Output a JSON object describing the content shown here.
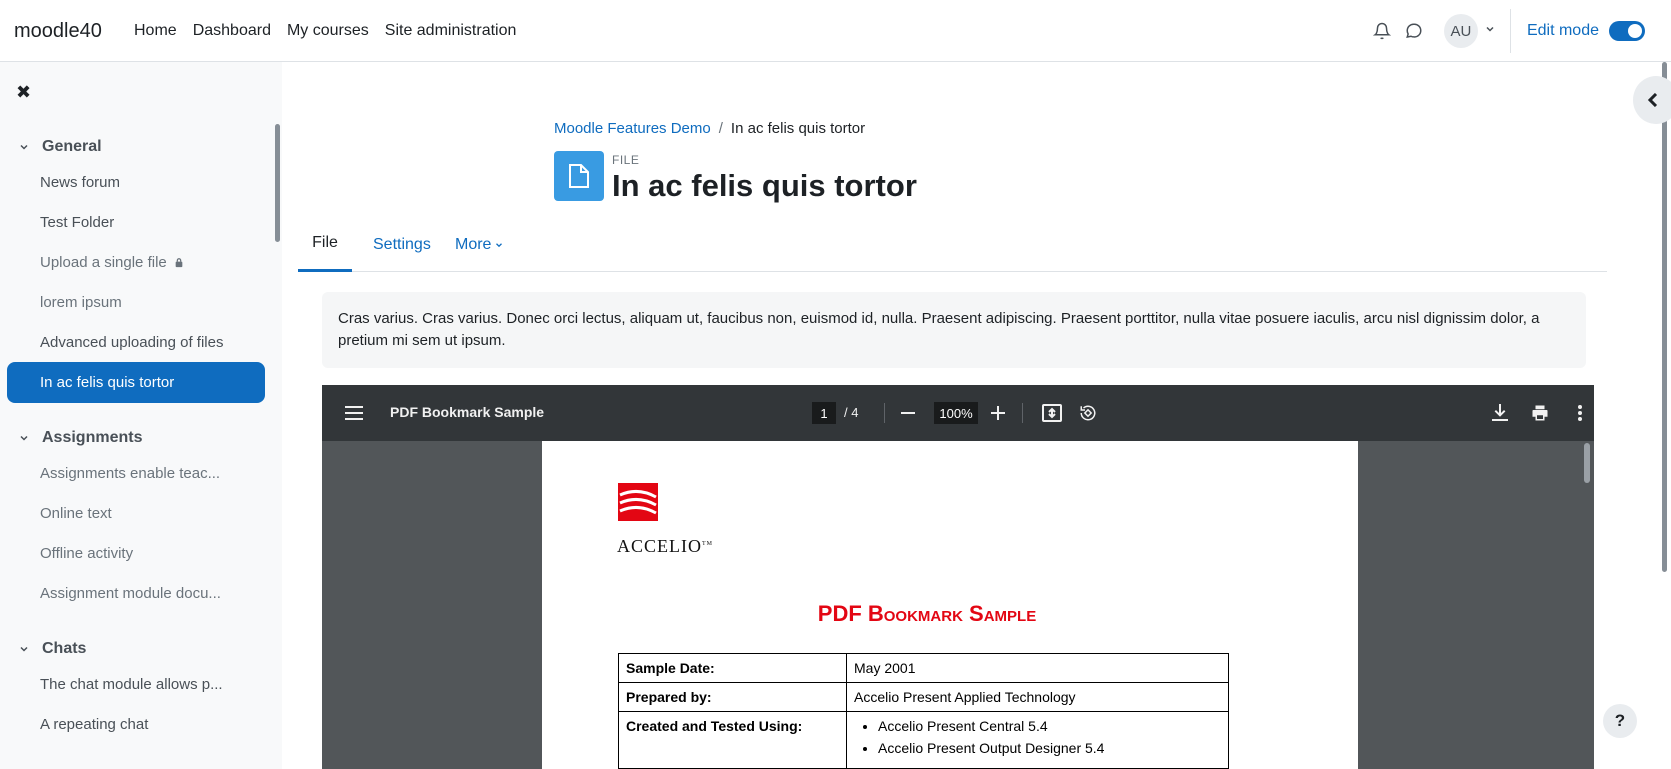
{
  "navbar": {
    "brand": "moodle40",
    "links": [
      "Home",
      "Dashboard",
      "My courses",
      "Site administration"
    ],
    "avatar_initials": "AU",
    "edit_mode_label": "Edit mode"
  },
  "drawer": {
    "sections": [
      {
        "title": "General",
        "items": [
          {
            "label": "News forum"
          },
          {
            "label": "Test Folder"
          },
          {
            "label": "Upload a single file"
          },
          {
            "label": "lorem ipsum"
          },
          {
            "label": "Advanced uploading of files"
          },
          {
            "label": "In ac felis quis tortor"
          }
        ]
      },
      {
        "title": "Assignments",
        "items": [
          {
            "label": "Assignments enable teac..."
          },
          {
            "label": "Online text"
          },
          {
            "label": "Offline activity"
          },
          {
            "label": "Assignment module docu..."
          }
        ]
      },
      {
        "title": "Chats",
        "items": [
          {
            "label": "The chat module allows p..."
          },
          {
            "label": "A repeating chat"
          }
        ]
      }
    ]
  },
  "main": {
    "breadcrumb": [
      "Moodle Features Demo",
      "In ac felis quis tortor"
    ],
    "activity_type": "FILE",
    "title": "In ac felis quis tortor",
    "tabs": [
      "File",
      "Settings",
      "More"
    ],
    "intro": "Cras varius. Cras varius. Donec orci lectus, aliquam ut, faucibus non, euismod id, nulla. Praesent adipiscing. Praesent porttitor, nulla vitae posuere iaculis, arcu nisl dignissim dolor, a pretium mi sem ut ipsum."
  },
  "pdf": {
    "filename": "PDF Bookmark Sample",
    "page_current": "1",
    "page_total": "/ 4",
    "zoom": "100%",
    "logo_text": "ACCELIO",
    "logo_tm": "TM",
    "doc_title": "PDF Bookmark Sample",
    "table": [
      {
        "key": "Sample Date:",
        "value": "May 2001"
      },
      {
        "key": "Prepared by:",
        "value": "Accelio Present Applied Technology"
      },
      {
        "key": "Created and Tested Using:",
        "list": [
          "Accelio Present Central 5.4",
          "Accelio Present Output Designer 5.4"
        ]
      }
    ]
  },
  "help_label": "?",
  "colors": {
    "primary": "#0f6cbf",
    "file_icon": "#399be2",
    "pdf_title": "#e30613"
  }
}
